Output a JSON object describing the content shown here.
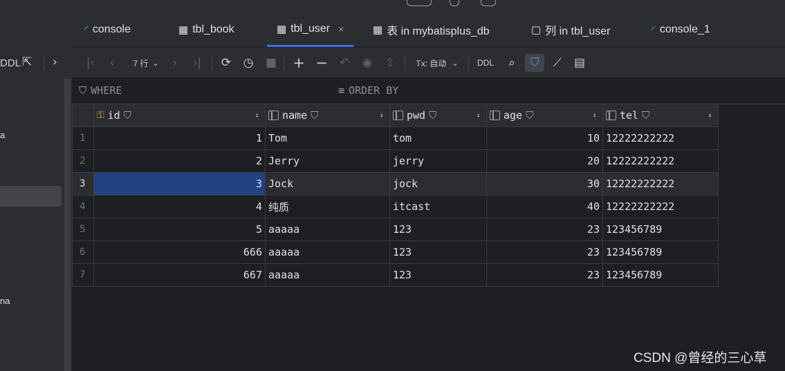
{
  "top_icons": [
    "ring-icon",
    "pill-icon",
    "bar-icon"
  ],
  "left_panel": {
    "toolbar": {
      "ddl_label": "DDL",
      "collapse_icon": "collapse-arrows-icon",
      "chevron_icon": "chevron-right-icon"
    },
    "fragments": [
      "a",
      "na"
    ]
  },
  "tabs": [
    {
      "label": "console",
      "icon": "console-icon"
    },
    {
      "label": "tbl_book",
      "icon": "table-icon"
    },
    {
      "label": "tbl_user",
      "icon": "table-icon",
      "active": true,
      "close": "×"
    },
    {
      "label": "表 in mybatisplus_db",
      "icon": "table-icon"
    },
    {
      "label": "列 in tbl_user",
      "icon": "column-icon"
    },
    {
      "label": "console_1",
      "icon": "console-icon"
    }
  ],
  "toolbar": {
    "row_count": "7 行",
    "tx_label": "Tx: 自动",
    "ddl_label": "DDL",
    "icons": [
      "first-page-icon",
      "prev-page-icon",
      "next-page-icon",
      "last-page-icon",
      "refresh-icon",
      "history-icon",
      "stop-icon",
      "add-row-icon",
      "remove-row-icon",
      "revert-icon",
      "preview-icon",
      "submit-icon",
      "search-icon",
      "filter-icon",
      "chart-icon",
      "export-icon"
    ]
  },
  "filter": {
    "where": "WHERE",
    "order_by": "ORDER BY"
  },
  "grid": {
    "columns": [
      {
        "name": "id",
        "key": true
      },
      {
        "name": "name"
      },
      {
        "name": "pwd"
      },
      {
        "name": "age"
      },
      {
        "name": "tel"
      }
    ],
    "rows": [
      {
        "n": "1",
        "id": "1",
        "name": "Tom",
        "pwd": "tom",
        "age": "10",
        "tel": "12222222222"
      },
      {
        "n": "2",
        "id": "2",
        "name": "Jerry",
        "pwd": "jerry",
        "age": "20",
        "tel": "12222222222"
      },
      {
        "n": "3",
        "id": "3",
        "name": "Jock",
        "pwd": "jock",
        "age": "30",
        "tel": "12222222222"
      },
      {
        "n": "4",
        "id": "4",
        "name": "纯质",
        "pwd": "itcast",
        "age": "40",
        "tel": "12222222222"
      },
      {
        "n": "5",
        "id": "5",
        "name": "aaaaa",
        "pwd": "123",
        "age": "23",
        "tel": "123456789"
      },
      {
        "n": "6",
        "id": "666",
        "name": "aaaaa",
        "pwd": "123",
        "age": "23",
        "tel": "123456789"
      },
      {
        "n": "7",
        "id": "667",
        "name": "aaaaa",
        "pwd": "123",
        "age": "23",
        "tel": "123456789"
      }
    ]
  },
  "watermark": "CSDN @曾经的三心草",
  "colors": {
    "selection": "#214283",
    "accent": "#3574f0",
    "key_icon": "#e8b34c"
  }
}
